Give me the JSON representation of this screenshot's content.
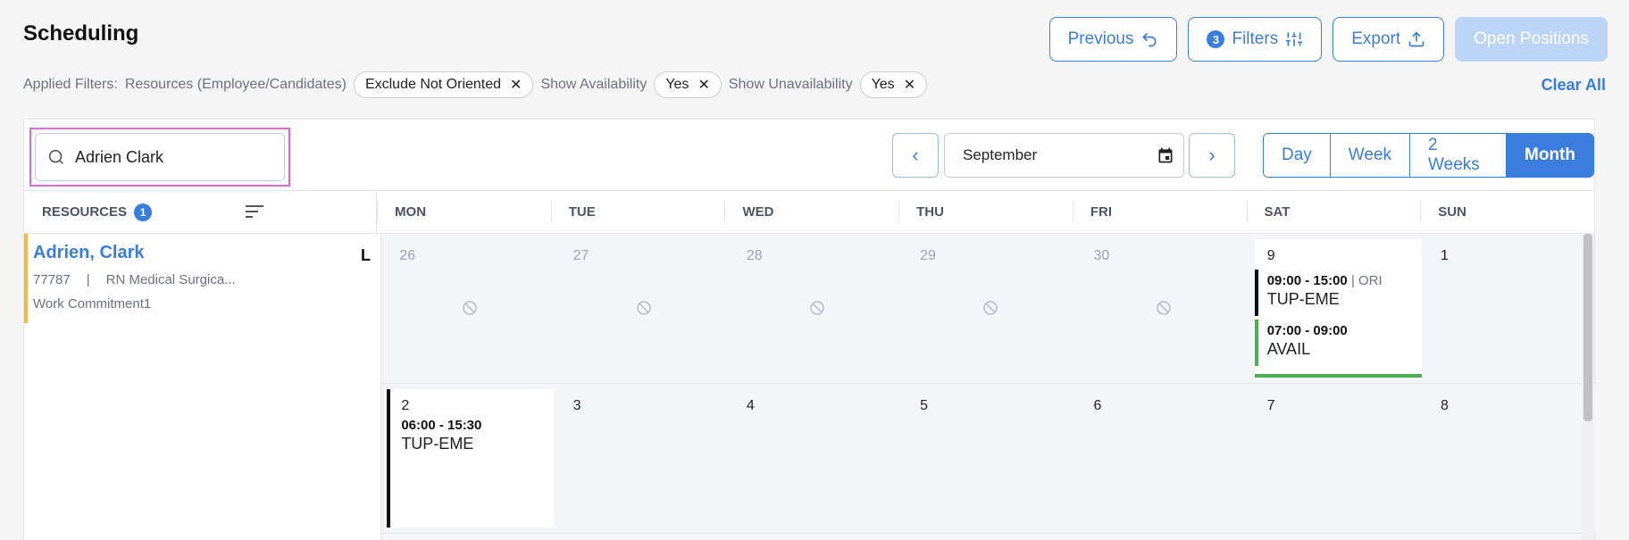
{
  "page": {
    "title": "Scheduling"
  },
  "top_buttons": {
    "previous": "Previous",
    "filters": "Filters",
    "filters_count": "3",
    "export": "Export",
    "open_positions": "Open Positions"
  },
  "applied_filters": {
    "label": "Applied Filters:",
    "groups": [
      {
        "label": "Resources (Employee/Candidates)",
        "value": "Exclude Not Oriented"
      },
      {
        "label": "Show Availability",
        "value": "Yes"
      },
      {
        "label": "Show Unavailability",
        "value": "Yes"
      }
    ],
    "clear_all": "Clear All"
  },
  "toolbar": {
    "search_value": "Adrien Clark",
    "month": "September",
    "views": [
      "Day",
      "Week",
      "2 Weeks",
      "Month"
    ],
    "active_view": "Month"
  },
  "grid_header": {
    "resources_label": "RESOURCES",
    "resources_count": "1",
    "days": [
      "MON",
      "TUE",
      "WED",
      "THU",
      "FRI",
      "SAT",
      "SUN"
    ]
  },
  "resource": {
    "name": "Adrien, Clark",
    "level": "L",
    "id": "77787",
    "separator": "|",
    "role": "RN Medical Surgica...",
    "commitment": "Work Commitment1"
  },
  "weeks": [
    {
      "days": [
        "26",
        "27",
        "28",
        "29",
        "30",
        "9",
        "1"
      ]
    },
    {
      "days": [
        "2",
        "3",
        "4",
        "5",
        "6",
        "7",
        "8"
      ]
    }
  ],
  "shifts": {
    "sat_1": {
      "time": "09:00 - 15:00",
      "tag": "| ORI",
      "location": "TUP-EME"
    },
    "sat_2": {
      "time": "07:00 - 09:00",
      "location": "AVAIL"
    },
    "mon_2": {
      "time": "06:00 - 15:30",
      "location": "TUP-EME"
    }
  },
  "colors": {
    "accent": "#3b7ddd",
    "avail": "#4caf50",
    "resource_bar": "#f4b942",
    "search_highlight": "#d96bd8"
  }
}
